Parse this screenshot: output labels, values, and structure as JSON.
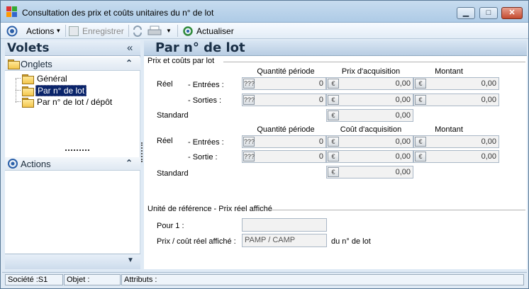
{
  "window": {
    "title": "Consultation des prix et coûts unitaires du n° de lot",
    "controls": {
      "minimize": "▁",
      "maximize": "□",
      "close": "✕"
    }
  },
  "toolbar": {
    "actions_label": "Actions",
    "save_label": "Enregistrer",
    "refresh_label": "Actualiser"
  },
  "sidebar": {
    "title": "Volets",
    "collapse_glyph": "«",
    "tabs_section": "Onglets",
    "items": [
      {
        "label": "Général",
        "selected": false
      },
      {
        "label": "Par n° de lot",
        "selected": true
      },
      {
        "label": "Par n° de lot / dépôt",
        "selected": false
      }
    ],
    "actions_section": "Actions"
  },
  "main": {
    "page_title": "Par n° de lot",
    "group1": {
      "title": "Prix et coûts par lot",
      "col_quantity": "Quantité période",
      "col_price": "Prix d'acquisition",
      "col_amount": "Montant",
      "reel_label": "Réel",
      "entries_label": "- Entrées :",
      "exits_label": "- Sorties :",
      "standard_label": "Standard",
      "rows": {
        "entries": {
          "quantity": "0",
          "price": "0,00",
          "amount": "0,00"
        },
        "exits": {
          "quantity": "0",
          "price": "0,00",
          "amount": "0,00"
        },
        "standard": {
          "price": "0,00"
        }
      }
    },
    "group2": {
      "col_quantity": "Quantité période",
      "col_cost": "Coût d'acquisition",
      "col_amount": "Montant",
      "reel_label": "Réel",
      "entries_label": "- Entrées :",
      "exits_label": "- Sortie :",
      "standard_label": "Standard",
      "rows": {
        "entries": {
          "quantity": "0",
          "cost": "0,00",
          "amount": "0,00"
        },
        "exits": {
          "quantity": "0",
          "cost": "0,00",
          "amount": "0,00"
        },
        "standard": {
          "cost": "0,00"
        }
      }
    },
    "reference": {
      "title": "Unité de référence - Prix réel affiché",
      "pour1_label": "Pour 1 :",
      "pour1_value": "",
      "displayed_label": "Prix / coût réel affiché :",
      "displayed_value": "PAMP / CAMP",
      "suffix": "du n° de lot"
    }
  },
  "status_bar": {
    "company": "Société :S1",
    "object": "Objet :",
    "attributes": "Attributs :"
  },
  "icons": {
    "quantity_glyph": "???",
    "currency_glyph": "€"
  }
}
